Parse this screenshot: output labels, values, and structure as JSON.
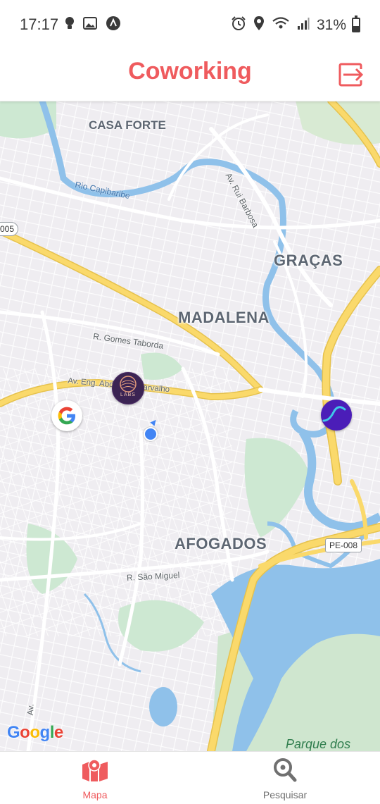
{
  "status_bar": {
    "time": "17:17",
    "battery": "31%",
    "left_icons": [
      "bulb-icon",
      "image-icon",
      "app-a-icon"
    ],
    "right_icons": [
      "alarm-icon",
      "location-pin-icon",
      "wifi-icon",
      "signal-icon",
      "battery-icon"
    ]
  },
  "header": {
    "title": "Coworking",
    "logout_icon": "logout-icon",
    "accent_color": "#ef5b5e"
  },
  "map": {
    "districts": [
      "CASA FORTE",
      "GRAÇAS",
      "MADALENA",
      "AFOGADOS"
    ],
    "streets": [
      "Av. Rui Barbosa",
      "R. Gomes Taborda",
      "Av. Eng. Abdias de Carvalho",
      "R. São Miguel",
      "Av."
    ],
    "river": "Rio Capibaribe",
    "road_shields": [
      "005",
      "PE-008"
    ],
    "park": "Parque dos",
    "marker_labs_text": "LABS",
    "google_logo": "Google"
  },
  "bottom_nav": {
    "tabs": [
      {
        "label": "Mapa",
        "icon": "map-icon",
        "active": true
      },
      {
        "label": "Pesquisar",
        "icon": "search-icon",
        "active": false
      }
    ],
    "active_color": "#ef5b5e",
    "inactive_color": "#707070"
  }
}
